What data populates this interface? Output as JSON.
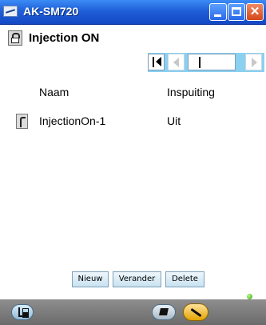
{
  "window": {
    "title": "AK-SM720"
  },
  "page": {
    "title": "Injection ON"
  },
  "navigator": {
    "record_value": ""
  },
  "table": {
    "columns": [
      "Naam",
      "Inspuiting"
    ],
    "rows": [
      {
        "name": "InjectionOn-1",
        "value": "Uit"
      }
    ]
  },
  "actions": {
    "new": "Nieuw",
    "edit": "Verander",
    "delete": "Delete"
  },
  "icons": [
    "app-icon",
    "lock-icon",
    "first-record-icon",
    "prev-record-icon",
    "next-record-icon",
    "wrench-icon",
    "tree-icon",
    "notes-icon",
    "tool-icon"
  ],
  "colors": {
    "titlebar": "#1f5fd8",
    "navbar": "#8ad0f0",
    "button": "#c9e2f1",
    "status": "#2f9a12"
  }
}
